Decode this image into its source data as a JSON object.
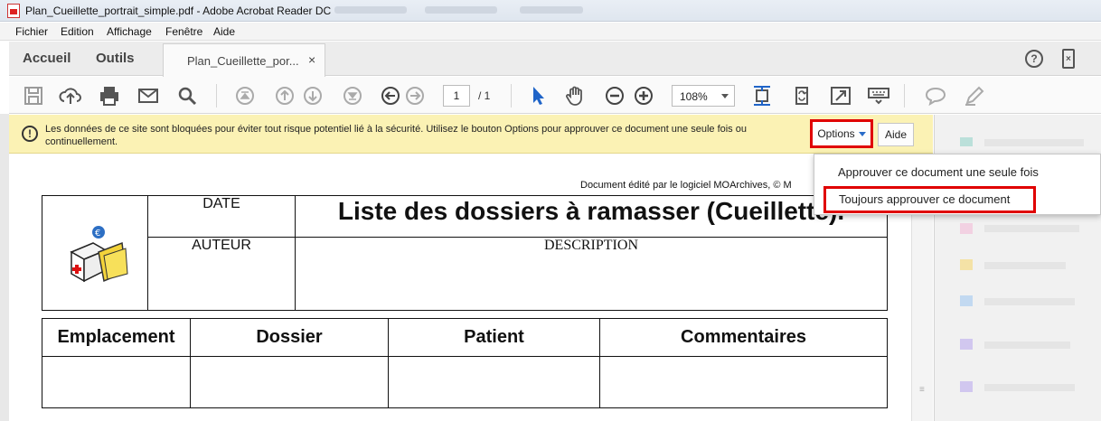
{
  "window": {
    "title": "Plan_Cueillette_portrait_simple.pdf - Adobe Acrobat Reader DC"
  },
  "menu": [
    "Fichier",
    "Edition",
    "Affichage",
    "Fenêtre",
    "Aide"
  ],
  "tabs": {
    "home": "Accueil",
    "tools": "Outils",
    "document": "Plan_Cueillette_por...",
    "close": "×"
  },
  "toolbar": {
    "page_current": "1",
    "page_total": "/ 1",
    "zoom": "108%",
    "icons": [
      "save-icon",
      "cloud-upload-icon",
      "print-icon",
      "email-icon",
      "search-icon",
      "first-page-icon",
      "previous-page-icon",
      "next-page-icon",
      "last-page-icon",
      "back-icon",
      "forward-icon",
      "select-cursor-icon",
      "hand-icon",
      "zoom-out-icon",
      "zoom-in-icon",
      "fit-page-icon",
      "rotate-icon",
      "fullscreen-icon",
      "keyboard-icon",
      "comment-icon",
      "pen-icon"
    ]
  },
  "notification": {
    "message": "Les données de ce site sont bloquées pour éviter tout risque potentiel lié à la sécurité. Utilisez le bouton Options pour approuver ce document une seule fois ou continuellement.",
    "options_label": "Options",
    "help_label": "Aide"
  },
  "dropdown": {
    "items": [
      "Approuver ce document une seule fois",
      "Toujours approuver ce document"
    ]
  },
  "document": {
    "edited_by": "Document édité par le logiciel MOArchives, © M",
    "date_label": "DATE",
    "author_label": "AUTEUR",
    "title": "Liste des dossiers à ramasser (Cueillette).",
    "description_label": "DESCRIPTION",
    "columns": [
      "Emplacement",
      "Dossier",
      "Patient",
      "Commentaires"
    ]
  },
  "colors": {
    "notification_bg": "#fbf2b4",
    "highlight_border": "#e00000",
    "accent_blue": "#2a6cc8"
  }
}
